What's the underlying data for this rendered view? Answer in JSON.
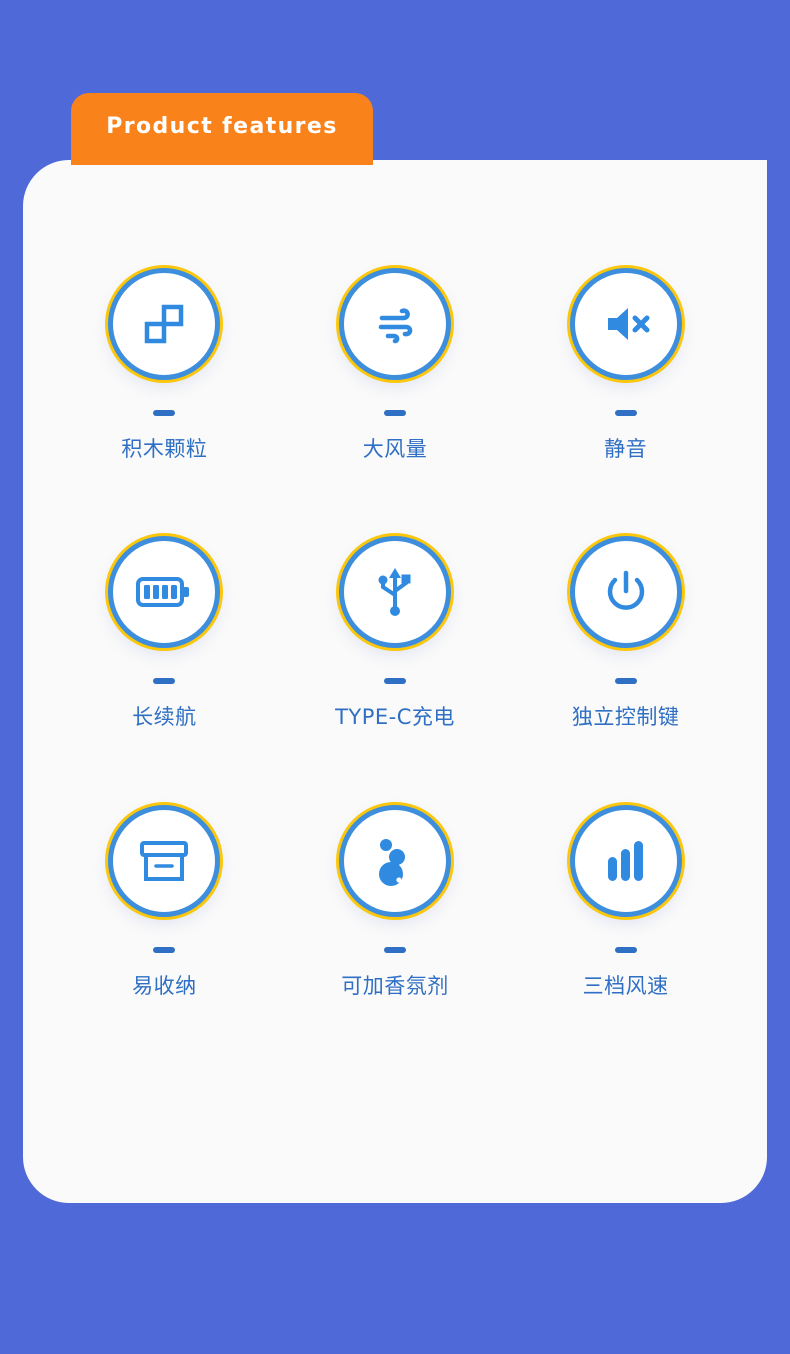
{
  "colors": {
    "background": "#4f69d8",
    "tab_orange": "#f9821a",
    "card_white": "#fafafa",
    "accent_yellow": "#fcc80f",
    "ring_blue": "#3e8ede",
    "text_blue": "#2f6fc4"
  },
  "header": {
    "title": "Product  features"
  },
  "features": [
    {
      "label": "积木颗粒",
      "icon": "building-blocks-icon"
    },
    {
      "label": "大风量",
      "icon": "wind-icon"
    },
    {
      "label": "静音",
      "icon": "mute-speaker-icon"
    },
    {
      "label": "长续航",
      "icon": "battery-full-icon"
    },
    {
      "label": "TYPE-C充电",
      "icon": "usb-icon"
    },
    {
      "label": "独立控制键",
      "icon": "power-button-icon"
    },
    {
      "label": "易收纳",
      "icon": "storage-box-icon"
    },
    {
      "label": "可加香氛剂",
      "icon": "droplets-icon"
    },
    {
      "label": "三档风速",
      "icon": "signal-bars-icon"
    }
  ]
}
